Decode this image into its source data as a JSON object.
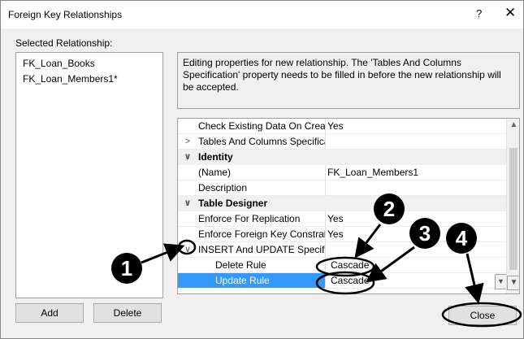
{
  "window": {
    "title": "Foreign Key Relationships",
    "help_label": "?",
    "close_label": "✕"
  },
  "selected_relationship": {
    "label": "Selected Relationship:",
    "items": [
      "FK_Loan_Books",
      "FK_Loan_Members1*"
    ]
  },
  "info_text": "Editing properties for new relationship.  The 'Tables And Columns Specification' property needs to be filled in before the new relationship will be accepted.",
  "grid": {
    "rows": [
      {
        "name": "Check Existing Data On Creati",
        "value": "Yes"
      },
      {
        "name": "Tables And Columns Specifica",
        "value": ""
      },
      {
        "name": "Identity",
        "value": ""
      },
      {
        "name": "(Name)",
        "value": "FK_Loan_Members1"
      },
      {
        "name": "Description",
        "value": ""
      },
      {
        "name": "Table Designer",
        "value": ""
      },
      {
        "name": "Enforce For Replication",
        "value": "Yes"
      },
      {
        "name": "Enforce Foreign Key Constrair",
        "value": "Yes"
      },
      {
        "name": "INSERT And UPDATE Specifica",
        "value": ""
      },
      {
        "name": "Delete Rule",
        "value": "Cascade"
      },
      {
        "name": "Update Rule",
        "value": "Cascade"
      }
    ]
  },
  "buttons": {
    "add": "Add",
    "delete": "Delete",
    "close": "Close"
  },
  "annotations": [
    "1",
    "2",
    "3",
    "4"
  ],
  "colors": {
    "selection": "#3399ff",
    "annotation": "#000000"
  }
}
